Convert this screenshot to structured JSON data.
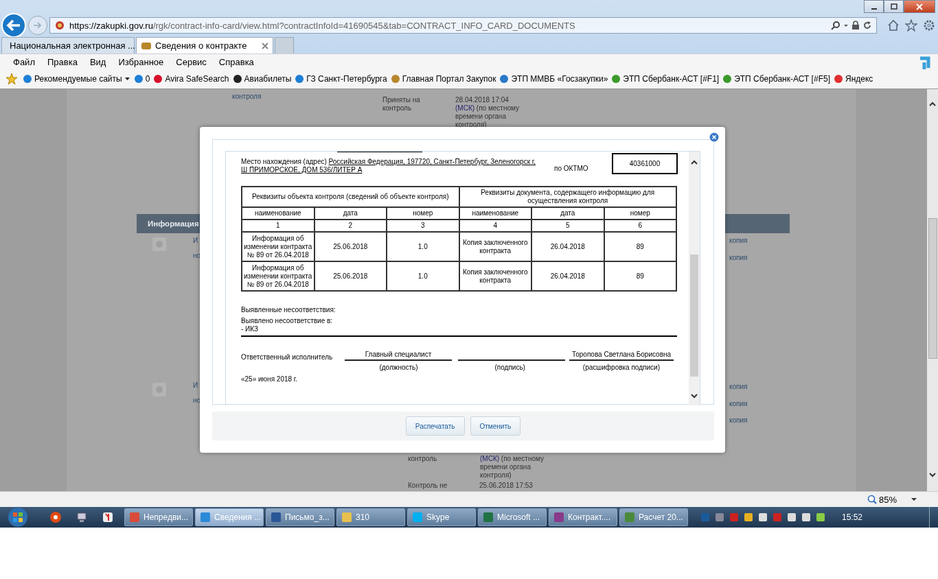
{
  "address_bar": {
    "host": "https://zakupki.gov.ru",
    "path": "/rgk/contract-info-card/view.html?contractInfoId=41690545&tab=CONTRACT_INFO_CARD_DOCUMENTS"
  },
  "tabs": [
    {
      "label": "Национальная электронная ...",
      "selected": false,
      "kind": "stripes"
    },
    {
      "label": "Сведения о контракте",
      "selected": true,
      "kind": "emblem"
    }
  ],
  "menu": [
    "Файл",
    "Правка",
    "Вид",
    "Избранное",
    "Сервис",
    "Справка"
  ],
  "favorites": [
    {
      "label": "Рекомендуемые сайты",
      "kind": "ie",
      "dropdown": true
    },
    {
      "label": "0",
      "kind": "ie",
      "dropdown": false
    },
    {
      "label": "Avira SafeSearch",
      "kind": "avira",
      "dropdown": false
    },
    {
      "label": "Авиабилеты",
      "kind": "plane",
      "dropdown": false
    },
    {
      "label": "ГЗ Санкт-Петербурга",
      "kind": "ie",
      "dropdown": false
    },
    {
      "label": "Главная Портал Закупок",
      "kind": "emblem",
      "dropdown": false
    },
    {
      "label": "ЭТП ММВБ «Госзакупки»",
      "kind": "stripes",
      "dropdown": false
    },
    {
      "label": "ЭТП Сбербанк-АСТ [#F1]",
      "kind": "green",
      "dropdown": false
    },
    {
      "label": "ЭТП Сбербанк-АСТ [#F5]",
      "kind": "green",
      "dropdown": false
    },
    {
      "label": "Яндекс",
      "kind": "yandex",
      "dropdown": false
    }
  ],
  "background_page": {
    "top_link": "контроля",
    "top_label": "Приняты на контроль",
    "top_date": "28.04.2018 17:04",
    "top_zone_link": "(МСК)",
    "top_zone_text": "(по местному времени органа контроля)",
    "section_title": "Информация",
    "link_fragments": [
      "И",
      "но",
      "И",
      "но"
    ],
    "copy_links": [
      "копия",
      "копия",
      "копия",
      "копия",
      "копия"
    ],
    "bottom_label": "контроль",
    "bottom_zone_link": "(МСК)",
    "bottom_zone_text": "(по местному времени органа контроля)",
    "bottom_label2": "Контроль не",
    "bottom_date": "25.06.2018 17:53"
  },
  "dialog": {
    "address_label": "Место нахождения (адрес)",
    "address_line1": "Российская Федерация, 197720, Санкт-Петербург, Зеленогорск г,",
    "address_line2": "Ш ПРИМОРСКОЕ, ДОМ 536/ЛИТЕР А",
    "oktmo_label": "по ОКТМО",
    "oktmo": "40361000",
    "table": {
      "group_headers": [
        "Реквизиты объекта контроля (сведений об объекте контроля)",
        "Реквизиты документа, содержащего информацию для осуществления контроля"
      ],
      "columns": [
        "наименование",
        "дата",
        "номер",
        "наименование",
        "дата",
        "номер"
      ],
      "column_numbers": [
        "1",
        "2",
        "3",
        "4",
        "5",
        "6"
      ],
      "rows": [
        [
          "Информация об изменении контракта № 89 от 26.04.2018",
          "25.06.2018",
          "1.0",
          "Копия заключенного контракта",
          "26.04.2018",
          "89"
        ],
        [
          "Информация об изменении контракта № 89 от 26.04.2018",
          "25.06.2018",
          "1.0",
          "Копия заключенного контракта",
          "26.04.2018",
          "89"
        ]
      ]
    },
    "findings_title": "Выявленные несоответствия:",
    "finding_label": "Выявлено несоответствие в:",
    "finding_item": "- ИКЗ",
    "executor_label": "Ответственный исполнитель",
    "position": "Главный специалист",
    "position_caption": "(должность)",
    "signature_caption": "(подпись)",
    "name": "Торопова Светлана Борисовна",
    "name_caption": "(расшифровка подписи)",
    "date": "«25» июня 2018 г.",
    "buttons": [
      "Распечатать",
      "Отменить"
    ]
  },
  "status_bar": {
    "zoom": "85%"
  },
  "taskbar": {
    "items": [
      {
        "label": "Непредви...",
        "kind": "chrome",
        "selected": false
      },
      {
        "label": "Сведения ...",
        "kind": "ie",
        "selected": true
      },
      {
        "label": "Письмо_з...",
        "kind": "word",
        "selected": false
      },
      {
        "label": "310",
        "kind": "folder",
        "selected": false
      },
      {
        "label": "Skype",
        "kind": "skype",
        "selected": false
      },
      {
        "label": "Microsoft ...",
        "kind": "excel",
        "selected": false
      },
      {
        "label": "Контракт....",
        "kind": "archive",
        "selected": false
      },
      {
        "label": "Расчет 20...",
        "kind": "calc",
        "selected": false
      }
    ],
    "clock": "15:52"
  }
}
